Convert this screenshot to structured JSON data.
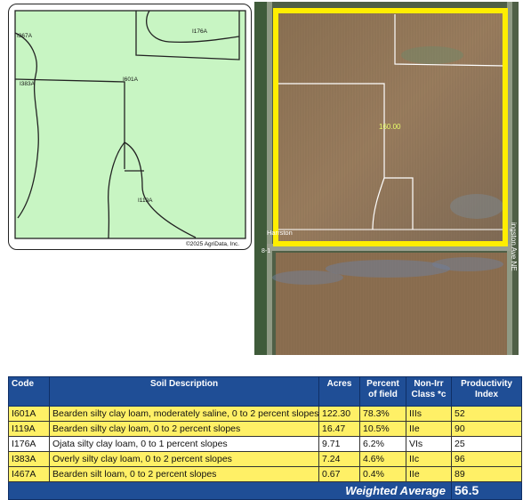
{
  "soil_map": {
    "labels": {
      "i367a": "I367A",
      "i176a": "I176A",
      "i383a": "I383A",
      "i601a": "I601A",
      "i119a": "I119A"
    },
    "copyright": "©2025 AgriData, Inc.",
    "fill_color": "#c8f5c3"
  },
  "aerial": {
    "acreage_label": "160.00",
    "road_label_1": "Harrston",
    "road_label_2": "ingston Ave NE",
    "road_label_3": "8-1",
    "boundary_color": "#ffee00"
  },
  "table": {
    "headers": {
      "code": "Code",
      "description": "Soil Description",
      "acres": "Acres",
      "percent": "Percent of field",
      "class": "Non-Irr Class *c",
      "pi": "Productivity Index"
    },
    "rows": [
      {
        "code": "I601A",
        "description": "Bearden silty clay loam, moderately saline, 0 to 2 percent slopes",
        "acres": "122.30",
        "percent": "78.3%",
        "class": "IIIs",
        "pi": "52"
      },
      {
        "code": "I119A",
        "description": "Bearden silty clay loam, 0 to 2 percent slopes",
        "acres": "16.47",
        "percent": "10.5%",
        "class": "IIe",
        "pi": "90"
      },
      {
        "code": "I176A",
        "description": "Ojata silty clay loam, 0 to 1 percent slopes",
        "acres": "9.71",
        "percent": "6.2%",
        "class": "VIs",
        "pi": "25"
      },
      {
        "code": "I383A",
        "description": "Overly silty clay loam, 0 to 2 percent slopes",
        "acres": "7.24",
        "percent": "4.6%",
        "class": "IIc",
        "pi": "96"
      },
      {
        "code": "I467A",
        "description": "Bearden silt loam, 0 to 2 percent slopes",
        "acres": "0.67",
        "percent": "0.4%",
        "class": "IIe",
        "pi": "89"
      }
    ],
    "weighted_label": "Weighted Average",
    "weighted_value": "56.5",
    "highlight_color": "#fff066",
    "header_color": "#1f4e96"
  }
}
